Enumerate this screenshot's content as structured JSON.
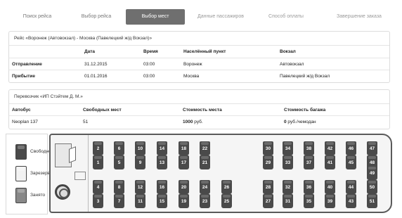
{
  "steps": [
    {
      "label": "Поиск рейса",
      "state": "done"
    },
    {
      "label": "Выбор рейса",
      "state": "done"
    },
    {
      "label": "Выбор мест",
      "state": "active"
    },
    {
      "label": "Данные пассажиров",
      "state": "future"
    },
    {
      "label": "Способ оплаты",
      "state": "future"
    },
    {
      "label": "Завершение заказа",
      "state": "future"
    }
  ],
  "trip": {
    "title": "Рейс «Воронеж (Автовокзал) - Москва (Павелецкий ж/д Вокзал)»",
    "headers": {
      "date": "Дата",
      "time": "Время",
      "locality": "Населённый пункт",
      "station": "Вокзал"
    },
    "departure": {
      "label": "Отправление",
      "date": "31.12.2015",
      "time": "03:00",
      "locality": "Воронеж",
      "station": "Автовокзал"
    },
    "arrival": {
      "label": "Прибытие",
      "date": "01.01.2016",
      "time": "03:00",
      "locality": "Москва",
      "station": "Павелецкий ж/д Вокзал"
    }
  },
  "carrier": {
    "title": "Перевозчик «ИП Стэйтем Д. М.»",
    "headers": {
      "bus": "Автобус",
      "free_seats": "Свободных мест",
      "seat_price": "Стоимость места",
      "baggage_price": "Стоимость багажа"
    },
    "bus": "Neoplan 137",
    "free_seats": "51",
    "seat_price_value": "1000",
    "seat_price_unit": " руб.",
    "baggage_price_value": "0",
    "baggage_price_unit": " руб./чемодан"
  },
  "legend": {
    "free": "Свободно",
    "reserved": "Зарезервировано",
    "occupied": "Занято"
  },
  "seats": {
    "row1": [
      "2",
      "6",
      "10",
      "14",
      "18",
      "22",
      "30",
      "34",
      "38",
      "42",
      "46",
      "47"
    ],
    "row2": [
      "1",
      "5",
      "9",
      "13",
      "17",
      "21",
      "29",
      "33",
      "37",
      "41",
      "45",
      "48"
    ],
    "row3": [
      "4",
      "8",
      "12",
      "16",
      "20",
      "24",
      "26",
      "28",
      "32",
      "36",
      "40",
      "44",
      "50",
      "49"
    ],
    "row4": [
      "3",
      "7",
      "11",
      "15",
      "19",
      "23",
      "25",
      "27",
      "31",
      "35",
      "39",
      "43",
      "51"
    ]
  },
  "colors": {
    "active_step": "#6f6f6f",
    "seat_free": "#4a4a4a",
    "seat_occupied": "#888888",
    "seat_reserved": "#f2f2f2"
  }
}
